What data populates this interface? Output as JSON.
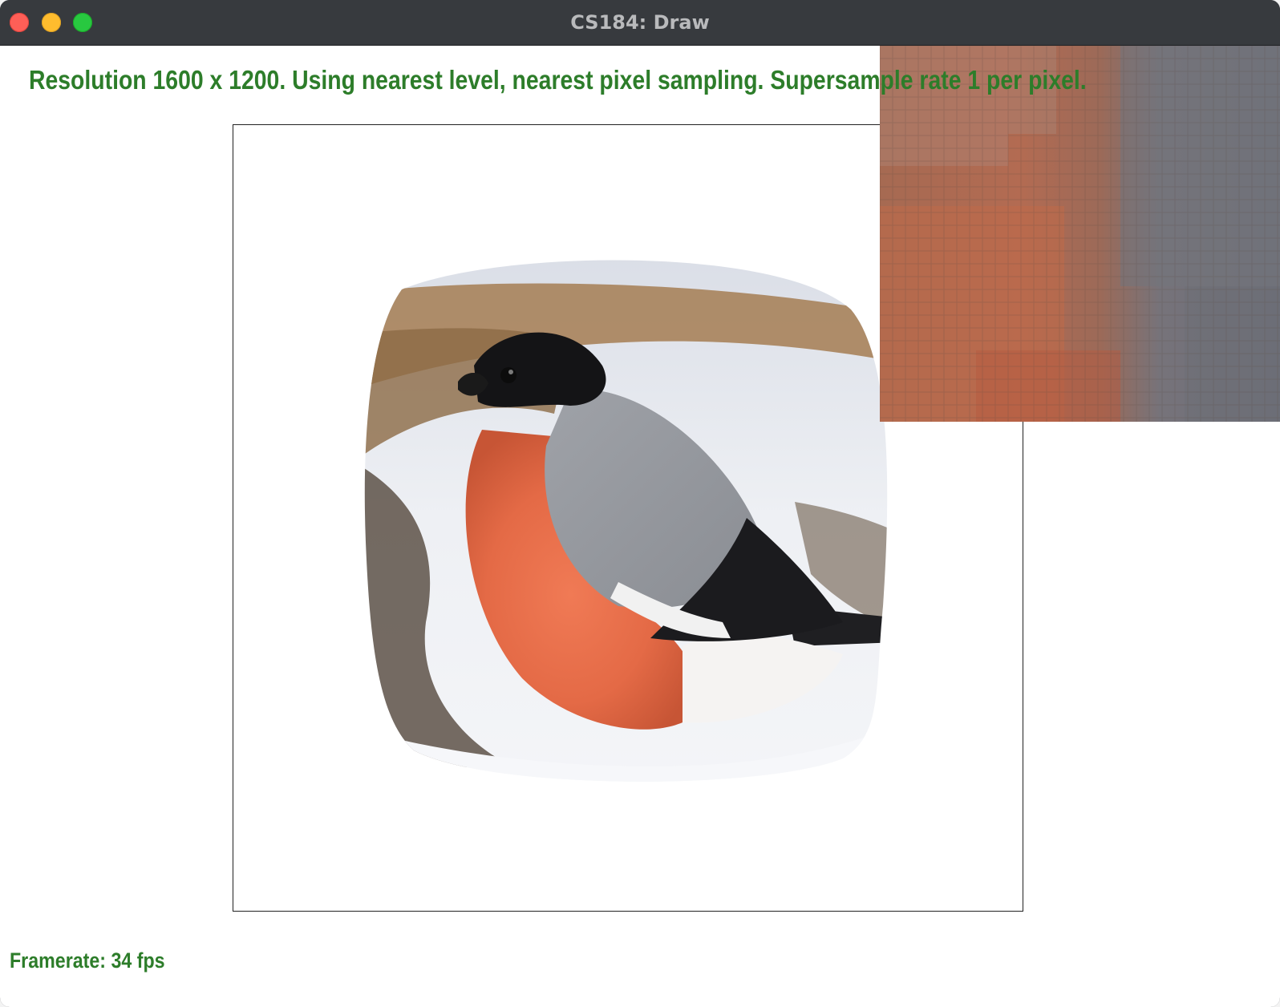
{
  "window": {
    "title": "CS184: Draw",
    "controls": {
      "close_icon": "close-icon",
      "minimize_icon": "minimize-icon",
      "maximize_icon": "maximize-icon"
    }
  },
  "status": {
    "resolution_text": "Resolution 1600 x 1200. Using nearest level, nearest pixel sampling. Supersample rate 1 per pixel.",
    "framerate_text": "Framerate: 34 fps"
  },
  "canvas": {
    "content": "bird texture warped on curved surface"
  },
  "zoom": {
    "content": "pixel inspector zoom"
  },
  "colors": {
    "status_text": "#2d7d2a",
    "titlebar": "#373a3e",
    "close": "#fe5f57",
    "minimize": "#febc2e",
    "maximize": "#28c840"
  }
}
